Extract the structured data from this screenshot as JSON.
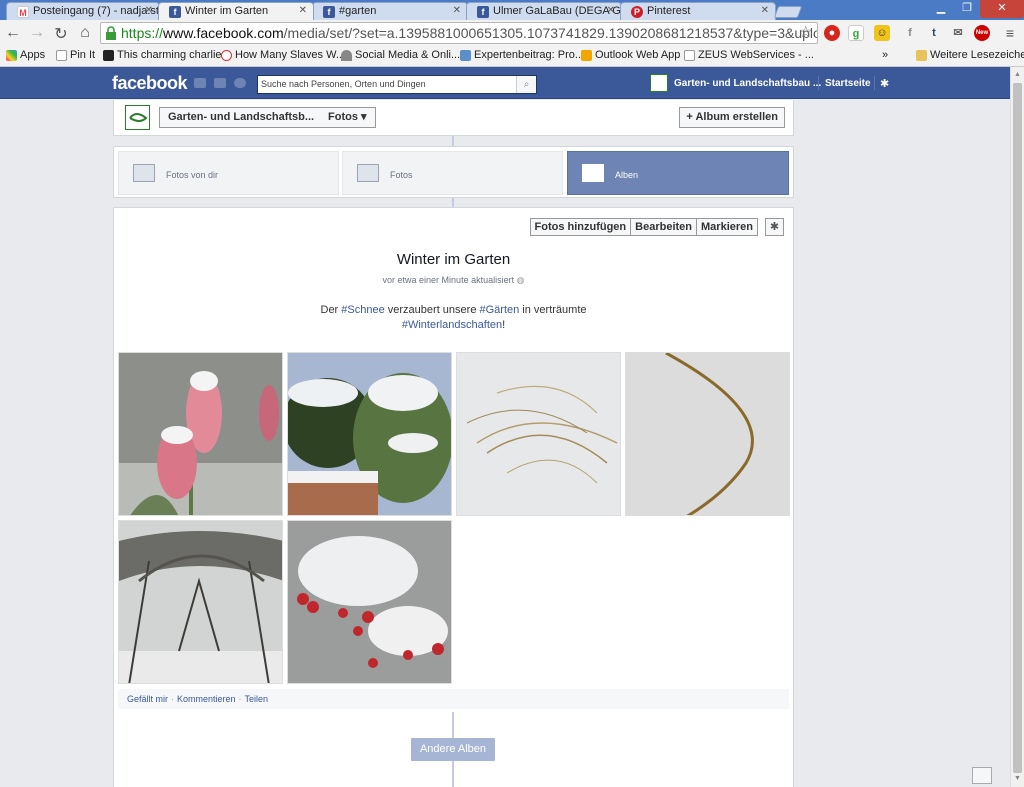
{
  "browser": {
    "tabs": [
      {
        "label": "Posteingang (7) - nadja.st",
        "icon": "gmail-icon",
        "active": false
      },
      {
        "label": "Winter im Garten",
        "icon": "facebook-icon",
        "active": true
      },
      {
        "label": "#garten",
        "icon": "facebook-icon",
        "active": false
      },
      {
        "label": "Ulmer GaLaBau (DEGA GA",
        "icon": "facebook-icon",
        "active": false
      },
      {
        "label": "Pinterest",
        "icon": "pinterest-icon",
        "active": false
      }
    ],
    "url_scheme": "https://",
    "url_host": "www.facebook.com",
    "url_path": "/media/set/?set=a.1395881000651305.1073741829.1390208681218537&type=3&uploaded=",
    "bookmarks": [
      {
        "label": "Apps"
      },
      {
        "label": "Pin It"
      },
      {
        "label": "This charming charlie"
      },
      {
        "label": "How Many Slaves W..."
      },
      {
        "label": "Social Media & Onli..."
      },
      {
        "label": "Expertenbeitrag: Pro..."
      },
      {
        "label": "Outlook Web App"
      },
      {
        "label": "ZEUS WebServices - ..."
      }
    ],
    "more_bookmarks_chevron": "»",
    "other_bookmarks": "Weitere Lesezeichen",
    "ext_badge": "New"
  },
  "facebook": {
    "logo": "facebook",
    "search_placeholder": "Suche nach Personen, Orten und Dingen",
    "page_name": "Garten- und Landschaftsbau ...",
    "home_label": "Startseite"
  },
  "album_header": {
    "page_select": "Garten- und Landschaftsb...",
    "section_select": "Fotos",
    "create_album": "+ Album erstellen"
  },
  "photo_tabs": [
    {
      "label": "Fotos von dir",
      "active": false
    },
    {
      "label": "Fotos",
      "active": false
    },
    {
      "label": "Alben",
      "active": true
    }
  ],
  "album": {
    "buttons": [
      "Fotos hinzufügen",
      "Bearbeiten",
      "Markieren"
    ],
    "title": "Winter im Garten",
    "updated": "vor etwa einer Minute aktualisiert",
    "desc_1": "Der ",
    "tag_1": "#Schnee",
    "desc_2": " verzaubert unsere ",
    "tag_2": "#Gärten",
    "desc_3": " in verträumte",
    "tag_3": "#Winterlandschaften",
    "desc_4": "!",
    "photos": [
      "snow-tulips-photo",
      "snowy-shrubs-wall-photo",
      "grass-in-snow-photo",
      "single-grass-blade-photo",
      "snowy-trees-path-photo",
      "snowy-red-berries-photo"
    ],
    "actions": [
      "Gefällt mir",
      "Kommentieren",
      "Teilen"
    ],
    "other_albums": "Andere Alben"
  },
  "colors": {
    "fb_blue": "#3b5998",
    "tab_active": "#6d84b4",
    "link": "#3b5998"
  }
}
